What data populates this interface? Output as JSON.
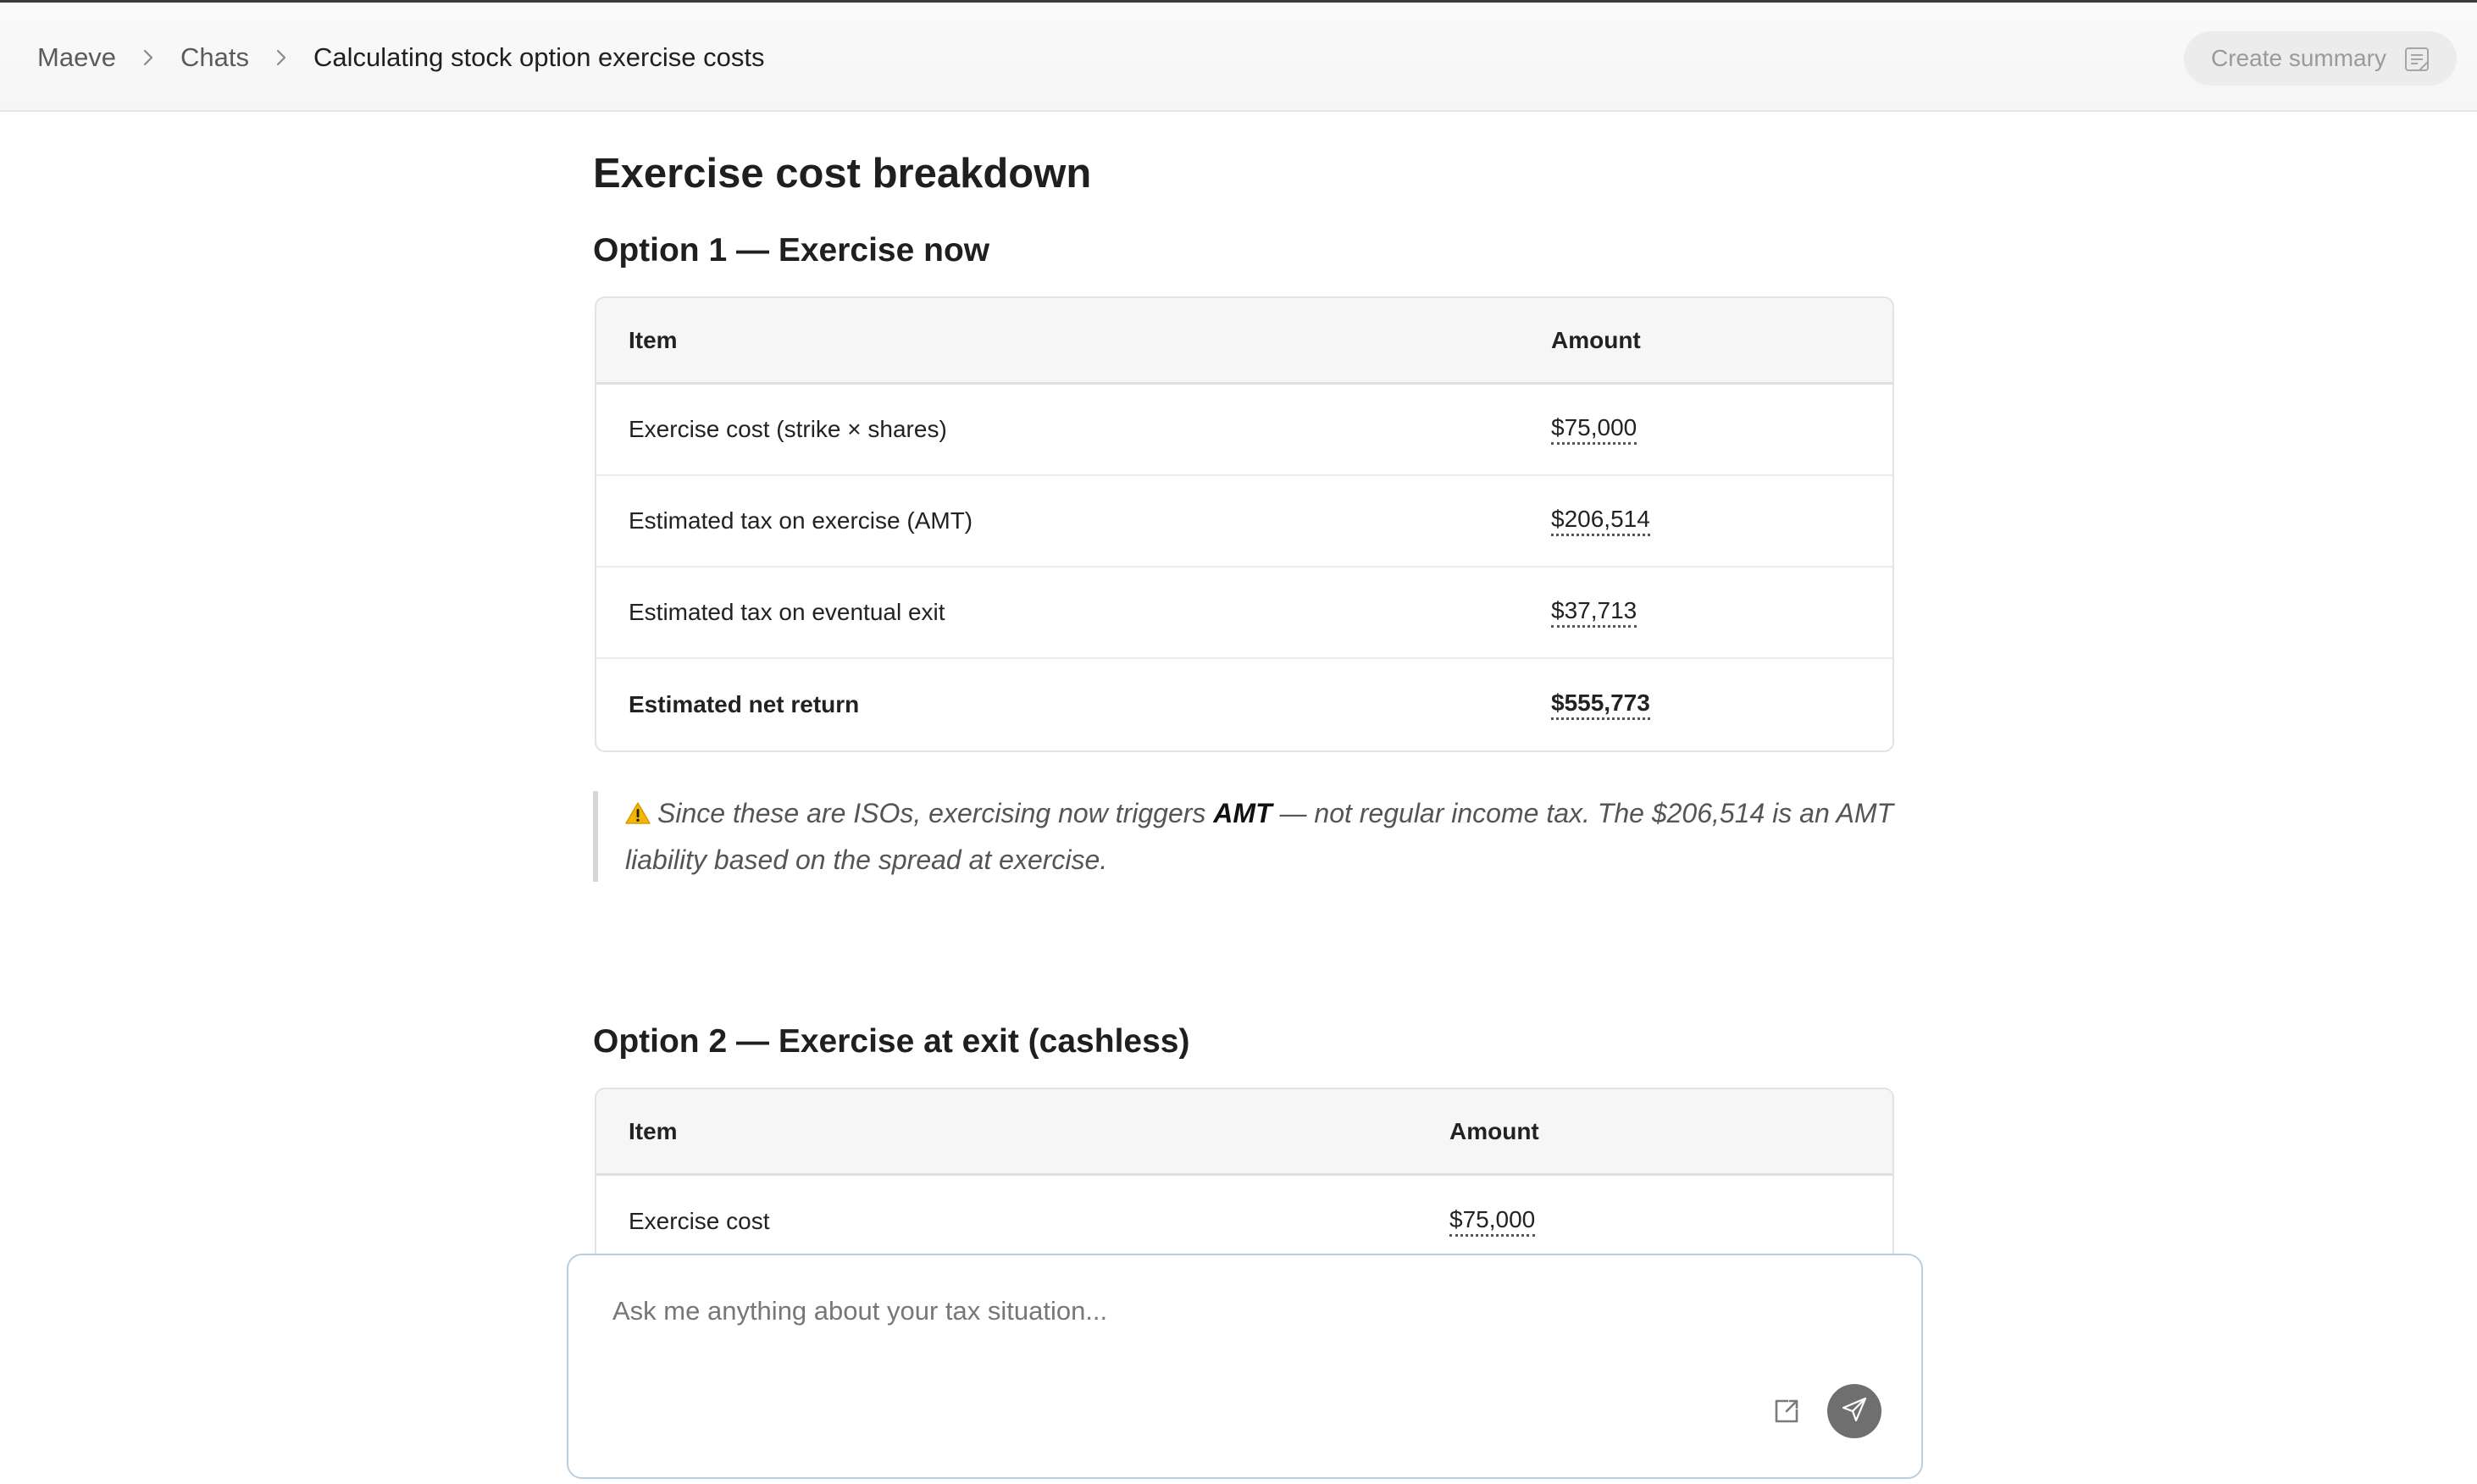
{
  "breadcrumb": {
    "root": "Maeve",
    "section": "Chats",
    "current": "Calculating stock option exercise costs"
  },
  "header": {
    "summary_label": "Create summary"
  },
  "content": {
    "title": "Exercise cost breakdown",
    "option1": {
      "title": "Option 1 — Exercise now",
      "columns": [
        "Item",
        "Amount"
      ],
      "rows": [
        {
          "item": "Exercise cost (strike × shares)",
          "amount": "$75,000"
        },
        {
          "item": "Estimated tax on exercise (AMT)",
          "amount": "$206,514"
        },
        {
          "item": "Estimated tax on eventual exit",
          "amount": "$37,713"
        },
        {
          "item": "Estimated net return",
          "amount": "$555,773"
        }
      ]
    },
    "callout": {
      "prefix": "Since these are ISOs, exercising now triggers ",
      "bold": "AMT",
      "suffix": " — not regular income tax. The $206,514 is an AMT liability based on the spread at exercise."
    },
    "option2": {
      "title": "Option 2 — Exercise at exit (cashless)",
      "columns": [
        "Item",
        "Amount"
      ],
      "rows": [
        {
          "item": "Exercise cost",
          "amount": "$75,000"
        }
      ]
    }
  },
  "composer": {
    "placeholder": "Ask me anything about your tax situation..."
  },
  "colors": {
    "accent_border": "#b9cfdf",
    "send_button": "#6f6f6f",
    "warning": "#f2b705"
  },
  "icons": [
    "chevron-right-icon",
    "summary-doc-icon",
    "warning-icon",
    "external-link-icon",
    "send-icon"
  ]
}
